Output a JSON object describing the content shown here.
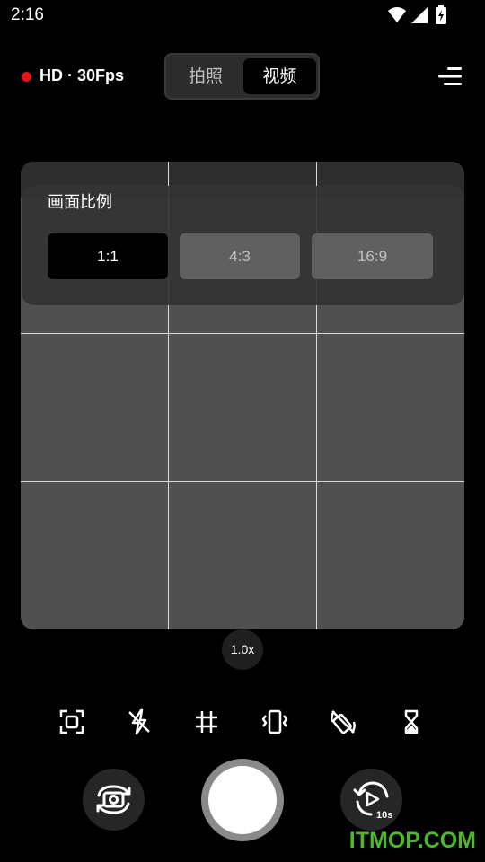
{
  "status_bar": {
    "time": "2:16"
  },
  "header": {
    "quality_label": "HD · 30Fps",
    "rec_color": "#e8141a"
  },
  "mode_toggle": {
    "photo_label": "拍照",
    "video_label": "视频",
    "selected": "视频"
  },
  "aspect_panel": {
    "title": "画面比例",
    "options": [
      "1:1",
      "4:3",
      "16:9"
    ],
    "selected": "1:1"
  },
  "zoom": {
    "level": "1.0x"
  },
  "toolbar": {
    "icons": [
      "focus-frame-icon",
      "flash-off-icon",
      "grid-icon",
      "vibrate-icon",
      "rotation-lock-off-icon",
      "hourglass-icon"
    ]
  },
  "bottom": {
    "timer_badge": "10s"
  },
  "watermark": {
    "text": "ITMOP.COM",
    "color": "#4cb82a"
  }
}
